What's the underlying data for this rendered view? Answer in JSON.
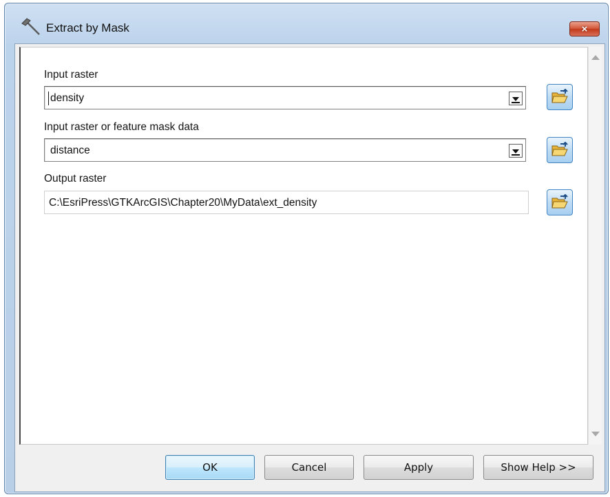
{
  "window": {
    "title": "Extract by Mask",
    "close_label": "×"
  },
  "form": {
    "input_raster": {
      "label": "Input raster",
      "value": "density"
    },
    "mask_data": {
      "label": "Input raster or feature mask data",
      "value": "distance"
    },
    "output_raster": {
      "label": "Output raster",
      "value": "C:\\EsriPress\\GTKArcGIS\\Chapter20\\MyData\\ext_density"
    }
  },
  "buttons": {
    "ok": "OK",
    "cancel": "Cancel",
    "apply": "Apply",
    "show_help": "Show Help >>"
  },
  "icons": {
    "title": "hammer-icon",
    "browse": "open-folder-icon",
    "dropdown": "chevron-down-icon"
  },
  "colors": {
    "close_button": "#c9452a",
    "browse_border": "#3f83c2",
    "default_button_border": "#3c7fb1"
  }
}
